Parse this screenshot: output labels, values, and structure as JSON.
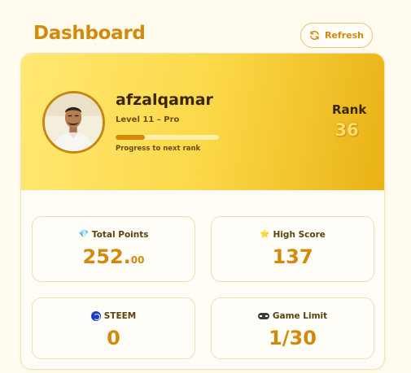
{
  "header": {
    "title": "Dashboard",
    "refresh_label": "Refresh"
  },
  "profile": {
    "username": "afzalqamar",
    "level": "Level 11 – Pro",
    "progress_fraction": 0.28,
    "progress_label": "Progress to next rank",
    "rank_label": "Rank",
    "rank_value": "36"
  },
  "stats": {
    "total_points": {
      "title": "Total Points",
      "icon": "gem-icon",
      "value_int": "252.",
      "value_dec": "00"
    },
    "high_score": {
      "title": "High Score",
      "icon": "star-icon",
      "value": "137"
    },
    "steem": {
      "title": "STEEM",
      "icon": "steem-icon",
      "value": "0"
    },
    "game_limit": {
      "title": "Game Limit",
      "icon": "gamepad-icon",
      "value": "1/30"
    }
  },
  "colors": {
    "accent": "#d38a0a",
    "background": "#fffbef",
    "hero_start": "#ffe873",
    "hero_end": "#e9b215"
  }
}
